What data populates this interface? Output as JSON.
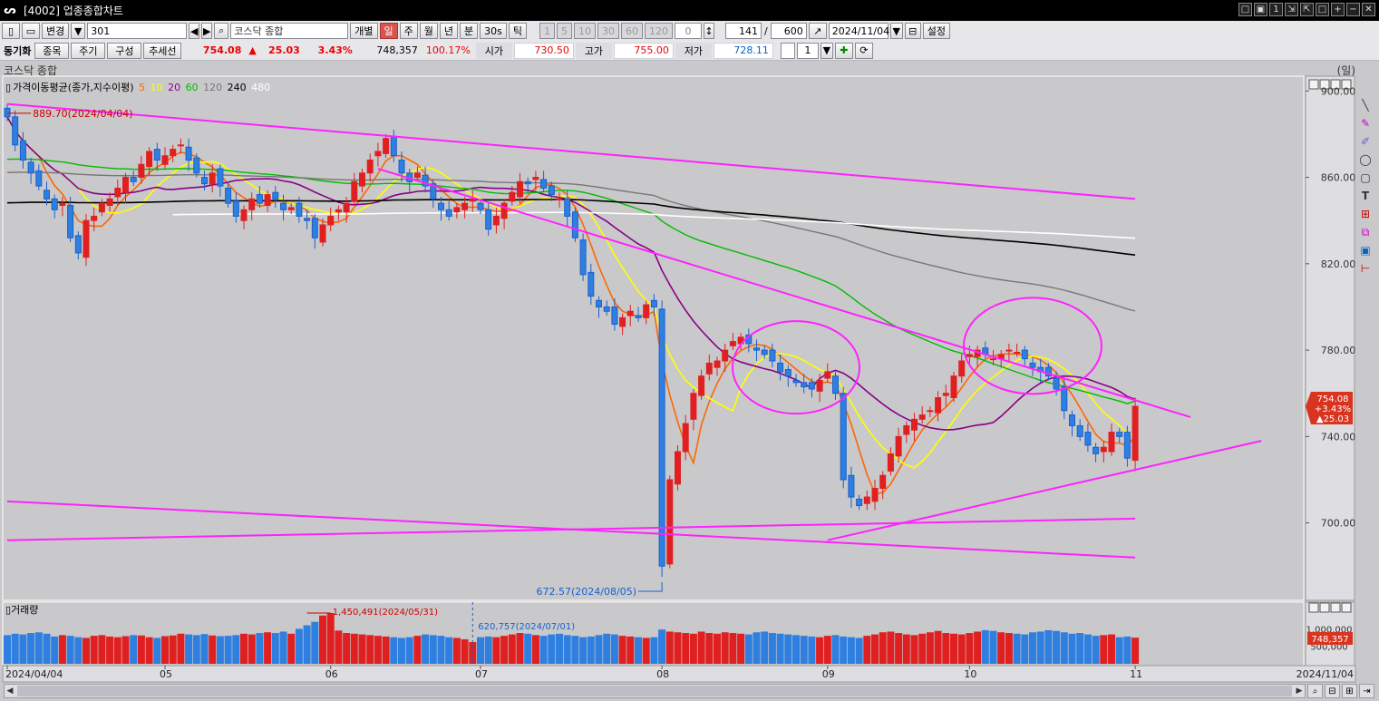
{
  "window": {
    "title": "[4002] 업종종합차트",
    "buttons": [
      "□",
      "▣",
      "1",
      "⇲",
      "⇱",
      "□",
      "+",
      "−",
      "✕"
    ]
  },
  "toolbar1": {
    "change_label": "변경",
    "code_value": "301",
    "name_value": "코스닥 종합",
    "individual_label": "개별",
    "periods": [
      "일",
      "주",
      "월",
      "년",
      "분",
      "30s",
      "틱"
    ],
    "active_period": "일",
    "intervals": [
      "1",
      "5",
      "10",
      "30",
      "60",
      "120"
    ],
    "interval_input": "0",
    "count_current": "141",
    "count_separator": "/",
    "count_total": "600",
    "date_value": "2024/11/04",
    "settings_label": "설정"
  },
  "toolbar2": {
    "sync_label": "동기화",
    "buttons": [
      "종목",
      "주기",
      "구성",
      "추세선"
    ],
    "price": "754.08",
    "change_arrow": "▲",
    "change": "25.03",
    "change_pct": "3.43%",
    "volume": "748,357",
    "volume_ratio": "100.17%",
    "open_label": "시가",
    "open_value": "730.50",
    "high_label": "고가",
    "high_value": "755.00",
    "low_label": "저가",
    "low_value": "728.11",
    "multi_value": "1"
  },
  "panel": {
    "title": "코스닥 종합",
    "unit": "(일)",
    "legend_title": "가격이동평균(종가,지수이평)",
    "ma_periods": [
      {
        "label": "5",
        "color": "#ff6600"
      },
      {
        "label": "10",
        "color": "#ffff00"
      },
      {
        "label": "20",
        "color": "#880088"
      },
      {
        "label": "60",
        "color": "#00bb00"
      },
      {
        "label": "120",
        "color": "#777777"
      },
      {
        "label": "240",
        "color": "#000000"
      },
      {
        "label": "480",
        "color": "#ffffff"
      }
    ],
    "price_tag": {
      "price": "754.08",
      "pct": "+3.43%",
      "change": "▲25.03"
    },
    "volume_label": "거래량",
    "volume_tag": "748,357",
    "annotations": {
      "high": "889.70(2024/04/04)",
      "low": "672.57(2024/08/05)",
      "vol_max": "1,450,491(2024/05/31)",
      "vol_mark": "620,757(2024/07/01)"
    }
  },
  "chart_data": {
    "type": "candlestick",
    "y_ticks": [
      "900.00",
      "860.00",
      "820.00",
      "780.00",
      "740.00",
      "700.00"
    ],
    "y_tick_values": [
      900,
      860,
      820,
      780,
      740,
      700
    ],
    "ylim": [
      665,
      906
    ],
    "volume_ticks": [
      "1,000,000",
      "500,000"
    ],
    "volume_tick_values": [
      1000000,
      500000
    ],
    "volume_max": 1450491,
    "x_labels": [
      {
        "label": "2024/04/04",
        "index": 0
      },
      {
        "label": "05",
        "index": 20
      },
      {
        "label": "06",
        "index": 41
      },
      {
        "label": "07",
        "index": 60
      },
      {
        "label": "08",
        "index": 83
      },
      {
        "label": "09",
        "index": 104
      },
      {
        "label": "10",
        "index": 122
      },
      {
        "label": "11",
        "index": 143
      }
    ],
    "x_end_label": "2024/11/04",
    "count": 144,
    "close": [
      888,
      875,
      868,
      862,
      856,
      850,
      845,
      848,
      832,
      825,
      840,
      842,
      848,
      850,
      855,
      860,
      858,
      866,
      872,
      868,
      870,
      873,
      875,
      868,
      862,
      857,
      862,
      856,
      848,
      842,
      845,
      850,
      848,
      852,
      850,
      845,
      846,
      842,
      840,
      832,
      838,
      842,
      845,
      848,
      858,
      862,
      868,
      872,
      878,
      870,
      862,
      858,
      862,
      856,
      850,
      845,
      842,
      846,
      848,
      850,
      845,
      836,
      842,
      848,
      853,
      858,
      857,
      860,
      855,
      852,
      850,
      842,
      832,
      815,
      805,
      800,
      798,
      792,
      795,
      798,
      795,
      801,
      800,
      680,
      720,
      733,
      746,
      760,
      768,
      774,
      775,
      780,
      784,
      786,
      783,
      780,
      778,
      775,
      770,
      768,
      765,
      763,
      762,
      766,
      770,
      760,
      720,
      712,
      708,
      712,
      716,
      722,
      732,
      740,
      745,
      748,
      750,
      752,
      758,
      760,
      768,
      775,
      778,
      780,
      778,
      776,
      778,
      780,
      779,
      776,
      772,
      770,
      768,
      762,
      752,
      745,
      740,
      736,
      732,
      735,
      742,
      740,
      730,
      754
    ],
    "volume": [
      820000,
      860000,
      840000,
      880000,
      900000,
      860000,
      780000,
      820000,
      800000,
      760000,
      740000,
      800000,
      820000,
      780000,
      760000,
      790000,
      820000,
      810000,
      760000,
      740000,
      790000,
      810000,
      860000,
      840000,
      820000,
      850000,
      810000,
      790000,
      800000,
      820000,
      860000,
      840000,
      880000,
      900000,
      880000,
      920000,
      860000,
      1000000,
      1100000,
      1200000,
      1380000,
      1450491,
      950000,
      880000,
      860000,
      840000,
      820000,
      800000,
      780000,
      760000,
      740000,
      760000,
      800000,
      840000,
      820000,
      800000,
      760000,
      740000,
      700000,
      620757,
      760000,
      780000,
      760000,
      800000,
      840000,
      880000,
      860000,
      820000,
      800000,
      840000,
      860000,
      820000,
      800000,
      760000,
      780000,
      820000,
      860000,
      840000,
      800000,
      780000,
      760000,
      740000,
      760000,
      980000,
      920000,
      900000,
      880000,
      860000,
      920000,
      880000,
      860000,
      900000,
      880000,
      860000,
      840000,
      900000,
      920000,
      880000,
      860000,
      840000,
      820000,
      800000,
      780000,
      760000,
      800000,
      820000,
      780000,
      760000,
      740000,
      800000,
      840000,
      900000,
      920000,
      880000,
      840000,
      820000,
      860000,
      900000,
      940000,
      880000,
      860000,
      840000,
      880000,
      920000,
      960000,
      940000,
      900000,
      880000,
      860000,
      840000,
      900000,
      920000,
      960000,
      940000,
      900000,
      860000,
      880000,
      840000,
      800000,
      820000,
      840000,
      760000,
      780000,
      748357
    ],
    "trendlines": [
      {
        "from": [
          0,
          894
        ],
        "to": [
          143,
          850
        ],
        "color": "#ff22ff"
      },
      {
        "from": [
          47,
          864
        ],
        "to": [
          150,
          749
        ],
        "color": "#ff22ff"
      },
      {
        "from": [
          0,
          710
        ],
        "to": [
          143,
          684
        ],
        "color": "#ff22ff"
      },
      {
        "from": [
          0,
          692
        ],
        "to": [
          143,
          702
        ],
        "color": "#ff22ff"
      },
      {
        "from": [
          104,
          692
        ],
        "to": [
          159,
          738
        ],
        "color": "#ff22ff"
      }
    ]
  }
}
